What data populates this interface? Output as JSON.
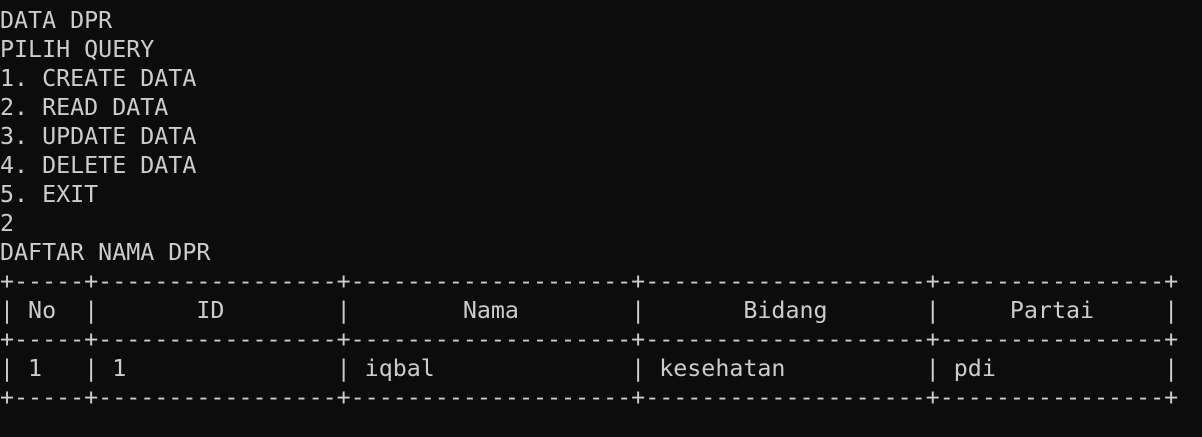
{
  "colors": {
    "background": "#0c0c0c",
    "foreground": "#cccccc"
  },
  "terminal": {
    "lines": [
      "DATA DPR",
      "PILIH QUERY",
      "1. CREATE DATA",
      "2. READ DATA",
      "3. UPDATE DATA",
      "4. DELETE DATA",
      "5. EXIT",
      "2",
      "DAFTAR NAMA DPR",
      "+-----+-----------------+--------------------+--------------------+----------------+",
      "| No  |       ID        |        Nama        |       Bidang       |     Partai     |",
      "+-----+-----------------+--------------------+--------------------+----------------+",
      "| 1   | 1               | iqbal              | kesehatan          | pdi            |",
      "+-----+-----------------+--------------------+--------------------+----------------+"
    ]
  }
}
